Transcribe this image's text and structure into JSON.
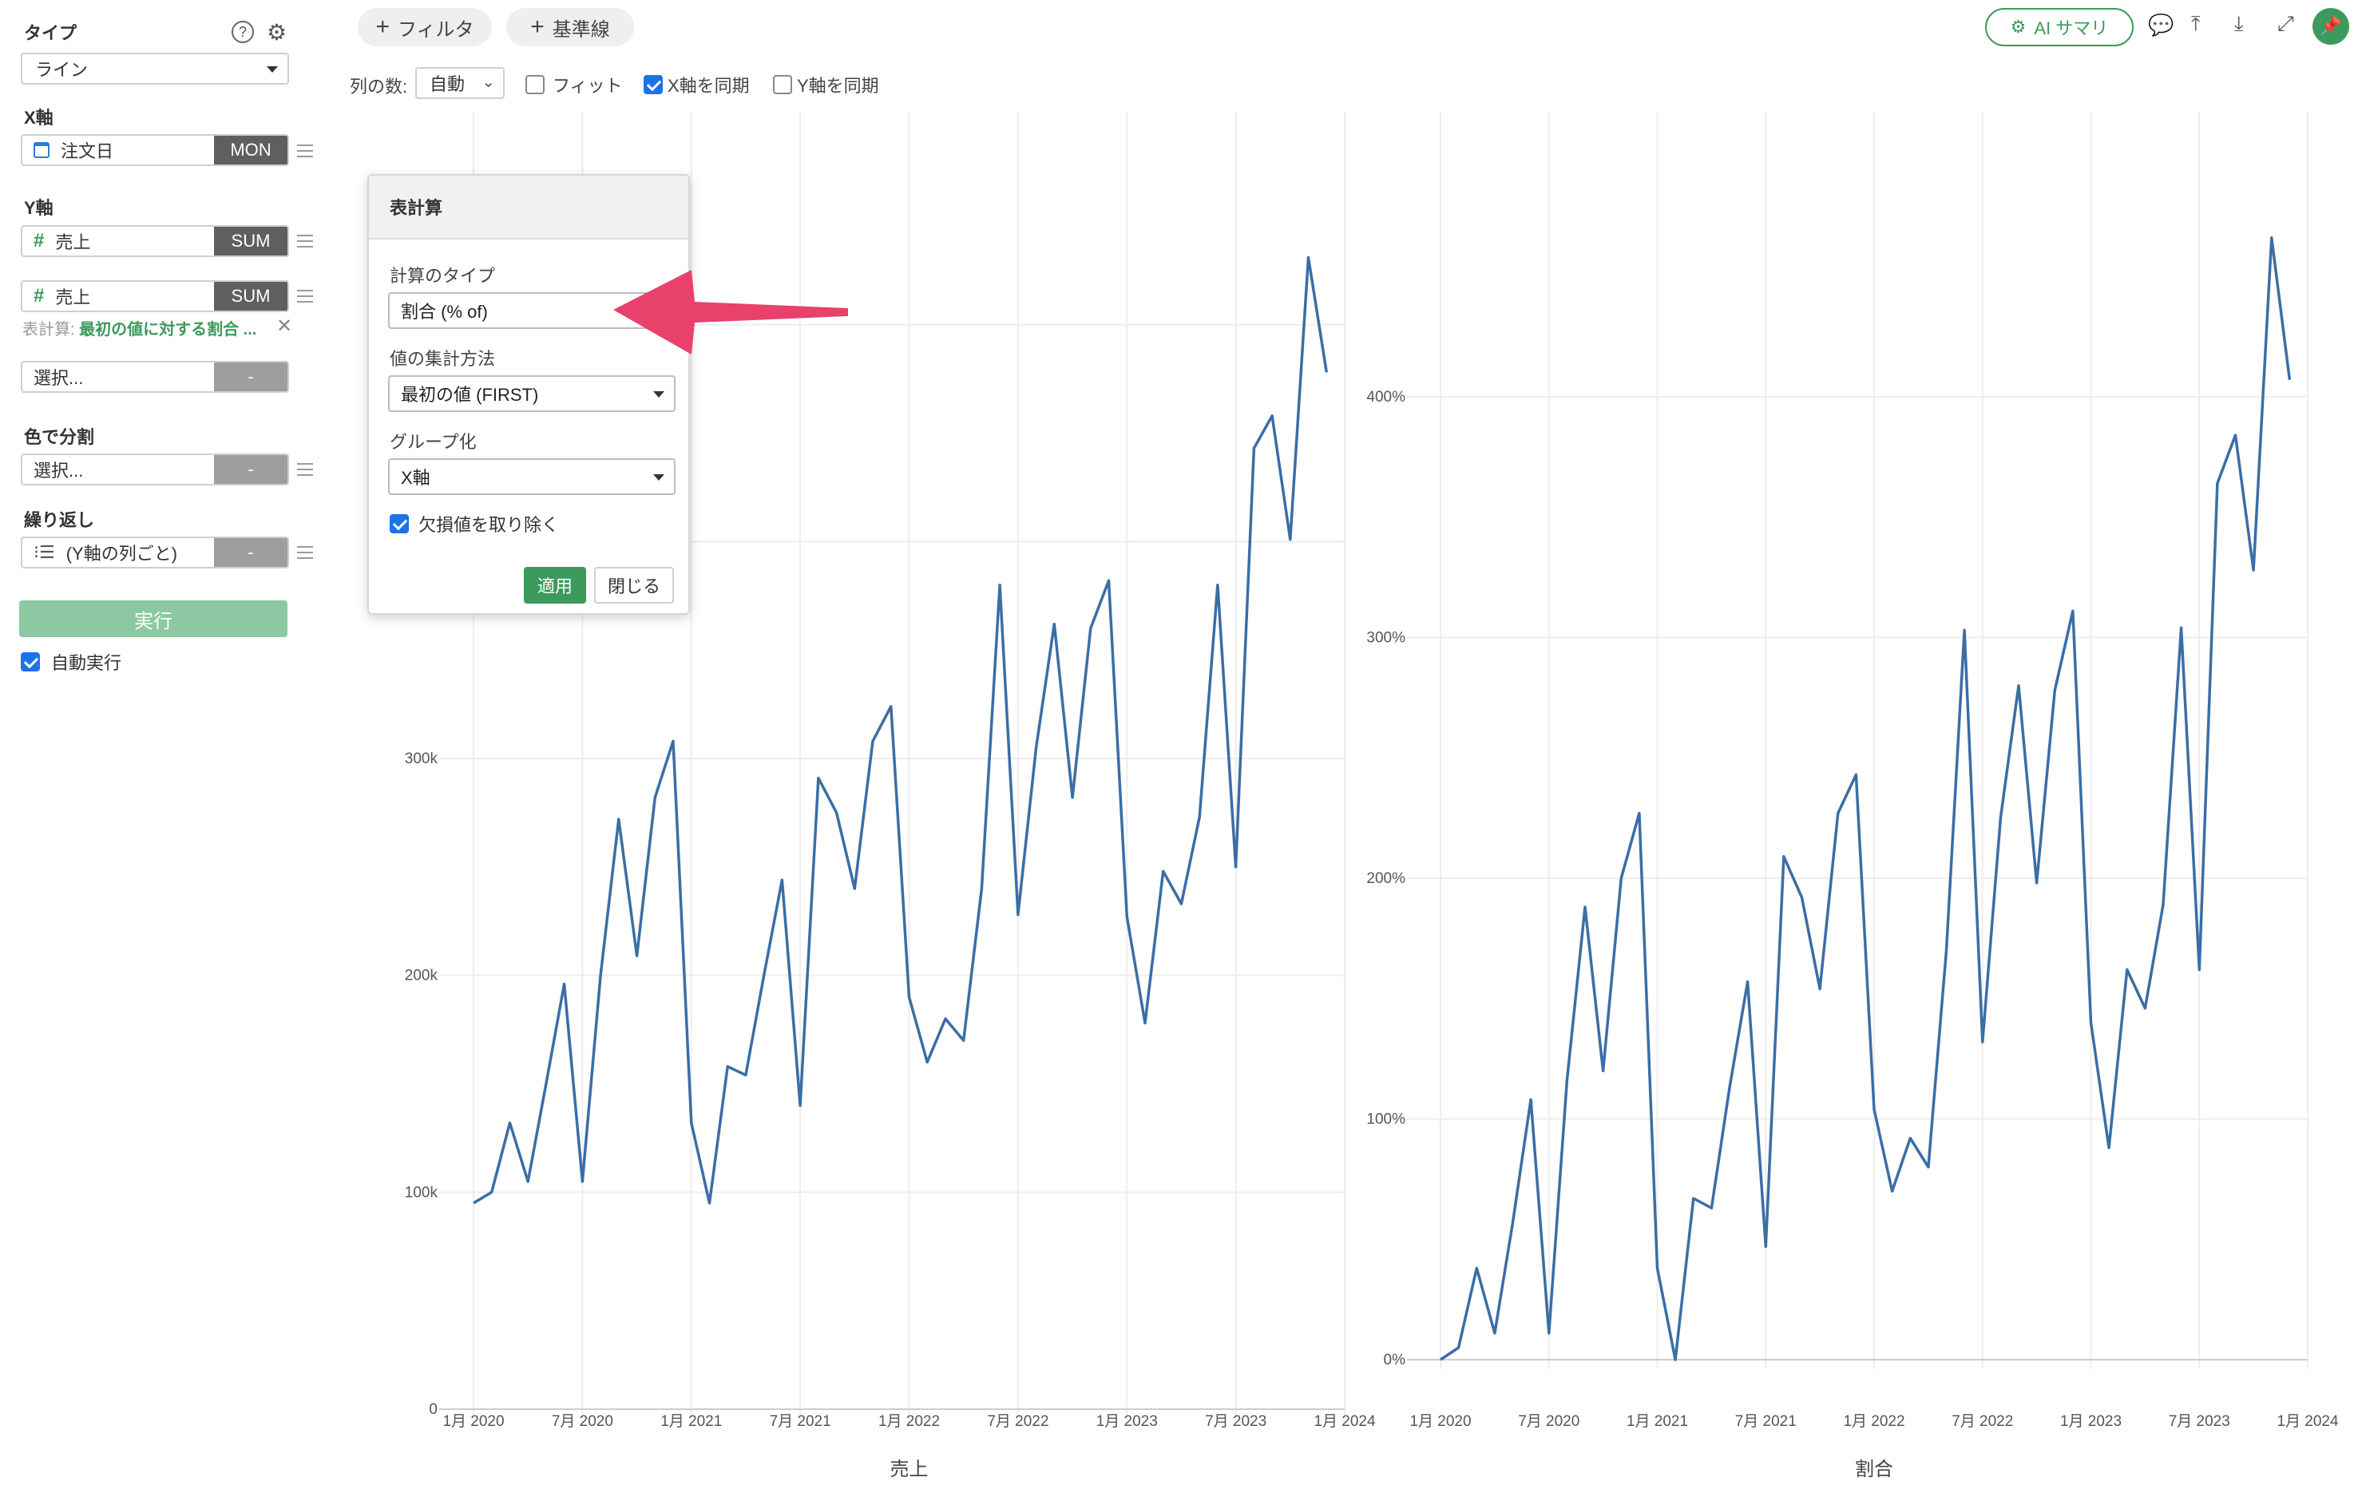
{
  "sidebar": {
    "type_label": "タイプ",
    "type_value": "ライン",
    "x_axis_label": "X軸",
    "x_field": {
      "name": "注文日",
      "agg": "MON"
    },
    "y_axis_label": "Y軸",
    "y_fields": [
      {
        "name": "売上",
        "agg": "SUM"
      },
      {
        "name": "売上",
        "agg": "SUM"
      }
    ],
    "table_calc_prefix": "表計算:",
    "table_calc_value": "最初の値に対する割合 ...",
    "y_extra_placeholder": "選択...",
    "y_extra_agg": "-",
    "color_label": "色で分割",
    "color_placeholder": "選択...",
    "color_agg": "-",
    "repeat_label": "繰り返し",
    "repeat_value": "(Y軸の列ごと)",
    "repeat_agg": "-",
    "run_button": "実行",
    "auto_run_label": "自動実行",
    "auto_run_checked": true,
    "accent_color": "#3c9a5c"
  },
  "toolbar": {
    "filter_button": "フィルタ",
    "baseline_button": "基準線",
    "columns_label": "列の数:",
    "columns_value": "自動",
    "fit_label": "フィット",
    "fit_checked": false,
    "sync_x_label": "X軸を同期",
    "sync_x_checked": true,
    "sync_y_label": "Y軸を同期",
    "sync_y_checked": false,
    "ai_summary_button": "AI サマリ",
    "icons": [
      "comment-icon",
      "upload-icon",
      "download-icon",
      "expand-icon",
      "pin-icon"
    ]
  },
  "popup": {
    "title": "表計算",
    "calc_type_label": "計算のタイプ",
    "calc_type_value": "割合 (% of)",
    "agg_method_label": "値の集計方法",
    "agg_method_value": "最初の値 (FIRST)",
    "group_label": "グループ化",
    "group_value": "X軸",
    "remove_missing_label": "欠損値を取り除く",
    "remove_missing_checked": true,
    "apply_button": "適用",
    "close_button": "閉じる"
  },
  "annotation": {
    "arrow_color": "#e8416b"
  },
  "chart_data": [
    {
      "type": "line",
      "xlabel": "売上",
      "ylabel": "",
      "ylim": [
        0,
        600000
      ],
      "yticks": [
        {
          "v": 0,
          "label": "0"
        },
        {
          "v": 100000,
          "label": "100k"
        },
        {
          "v": 200000,
          "label": "200k"
        },
        {
          "v": 300000,
          "label": "300k"
        }
      ],
      "xticks": [
        "1月 2020",
        "7月 2020",
        "1月 2021",
        "7月 2021",
        "1月 2022",
        "7月 2022",
        "1月 2023",
        "7月 2023",
        "1月 2024"
      ],
      "color": "#3a6ea5",
      "x": [
        "2020-01",
        "2020-02",
        "2020-03",
        "2020-04",
        "2020-05",
        "2020-06",
        "2020-07",
        "2020-08",
        "2020-09",
        "2020-10",
        "2020-11",
        "2020-12",
        "2021-01",
        "2021-02",
        "2021-03",
        "2021-04",
        "2021-05",
        "2021-06",
        "2021-07",
        "2021-08",
        "2021-09",
        "2021-10",
        "2021-11",
        "2021-12",
        "2022-01",
        "2022-02",
        "2022-03",
        "2022-04",
        "2022-05",
        "2022-06",
        "2022-07",
        "2022-08",
        "2022-09",
        "2022-10",
        "2022-11",
        "2022-12",
        "2023-01",
        "2023-02",
        "2023-03",
        "2023-04",
        "2023-05",
        "2023-06",
        "2023-07",
        "2023-08",
        "2023-09",
        "2023-10",
        "2023-11",
        "2023-12"
      ],
      "values": [
        95000,
        100000,
        132000,
        105000,
        150000,
        196000,
        105000,
        200000,
        272000,
        209000,
        282000,
        308000,
        132000,
        95000,
        158000,
        154000,
        200000,
        244000,
        140000,
        291000,
        275000,
        240000,
        308000,
        324000,
        190000,
        160000,
        180000,
        170000,
        240000,
        380000,
        228000,
        305000,
        362000,
        282000,
        360000,
        382000,
        227000,
        178000,
        248000,
        233000,
        273000,
        380000,
        250000,
        443000,
        458000,
        401000,
        531000,
        478000
      ]
    },
    {
      "type": "line",
      "xlabel": "割合",
      "ylabel": "",
      "ylim": [
        0,
        520
      ],
      "yticks": [
        {
          "v": 0,
          "label": "0%"
        },
        {
          "v": 100,
          "label": "100%"
        },
        {
          "v": 200,
          "label": "200%"
        },
        {
          "v": 300,
          "label": "300%"
        },
        {
          "v": 400,
          "label": "400%"
        }
      ],
      "xticks": [
        "1月 2020",
        "7月 2020",
        "1月 2021",
        "7月 2021",
        "1月 2022",
        "7月 2022",
        "1月 2023",
        "7月 2023",
        "1月 2024"
      ],
      "color": "#3a6ea5",
      "x": [
        "2020-01",
        "2020-02",
        "2020-03",
        "2020-04",
        "2020-05",
        "2020-06",
        "2020-07",
        "2020-08",
        "2020-09",
        "2020-10",
        "2020-11",
        "2020-12",
        "2021-01",
        "2021-02",
        "2021-03",
        "2021-04",
        "2021-05",
        "2021-06",
        "2021-07",
        "2021-08",
        "2021-09",
        "2021-10",
        "2021-11",
        "2021-12",
        "2022-01",
        "2022-02",
        "2022-03",
        "2022-04",
        "2022-05",
        "2022-06",
        "2022-07",
        "2022-08",
        "2022-09",
        "2022-10",
        "2022-11",
        "2022-12",
        "2023-01",
        "2023-02",
        "2023-03",
        "2023-04",
        "2023-05",
        "2023-06",
        "2023-07",
        "2023-08",
        "2023-09",
        "2023-10",
        "2023-11",
        "2023-12"
      ],
      "values": [
        0,
        5,
        38,
        11,
        57,
        108,
        11,
        116,
        188,
        120,
        200,
        227,
        38,
        0,
        67,
        63,
        113,
        157,
        47,
        209,
        192,
        154,
        227,
        243,
        104,
        70,
        92,
        80,
        170,
        303,
        132,
        225,
        280,
        198,
        278,
        311,
        140,
        88,
        162,
        146,
        189,
        304,
        162,
        364,
        384,
        328,
        466,
        407
      ]
    }
  ]
}
